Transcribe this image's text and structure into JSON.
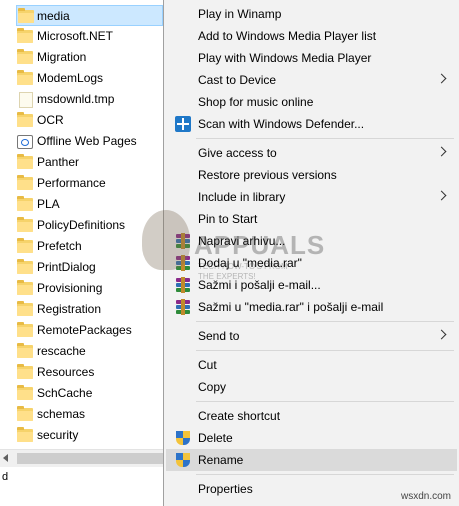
{
  "explorer": {
    "files": [
      {
        "name": "media",
        "type": "folder",
        "selected": true
      },
      {
        "name": "Microsoft.NET",
        "type": "folder"
      },
      {
        "name": "Migration",
        "type": "folder"
      },
      {
        "name": "ModemLogs",
        "type": "folder"
      },
      {
        "name": "msdownld.tmp",
        "type": "file"
      },
      {
        "name": "OCR",
        "type": "folder"
      },
      {
        "name": "Offline Web Pages",
        "type": "shortcut"
      },
      {
        "name": "Panther",
        "type": "folder"
      },
      {
        "name": "Performance",
        "type": "folder"
      },
      {
        "name": "PLA",
        "type": "folder"
      },
      {
        "name": "PolicyDefinitions",
        "type": "folder"
      },
      {
        "name": "Prefetch",
        "type": "folder"
      },
      {
        "name": "PrintDialog",
        "type": "folder"
      },
      {
        "name": "Provisioning",
        "type": "folder"
      },
      {
        "name": "Registration",
        "type": "folder"
      },
      {
        "name": "RemotePackages",
        "type": "folder"
      },
      {
        "name": "rescache",
        "type": "folder"
      },
      {
        "name": "Resources",
        "type": "folder"
      },
      {
        "name": "SchCache",
        "type": "folder"
      },
      {
        "name": "schemas",
        "type": "folder"
      },
      {
        "name": "security",
        "type": "folder"
      }
    ],
    "status_mark": "d"
  },
  "context_menu": {
    "items": [
      {
        "label": "Play in Winamp"
      },
      {
        "label": "Add to Windows Media Player list"
      },
      {
        "label": "Play with Windows Media Player"
      },
      {
        "label": "Cast to Device",
        "submenu": true
      },
      {
        "label": "Shop for music online"
      },
      {
        "label": "Scan with Windows Defender...",
        "icon": "defender"
      },
      {
        "separator": true
      },
      {
        "label": "Give access to",
        "submenu": true
      },
      {
        "label": "Restore previous versions"
      },
      {
        "label": "Include in library",
        "submenu": true
      },
      {
        "label": "Pin to Start"
      },
      {
        "label": "Napravi arhivu...",
        "icon": "winrar"
      },
      {
        "label": "Dodaj u \"media.rar\"",
        "icon": "winrar"
      },
      {
        "label": "Sažmi i pošalji e-mail...",
        "icon": "winrar"
      },
      {
        "label": "Sažmi u \"media.rar\" i pošalji e-mail",
        "icon": "winrar"
      },
      {
        "separator": true
      },
      {
        "label": "Send to",
        "submenu": true
      },
      {
        "separator": true
      },
      {
        "label": "Cut"
      },
      {
        "label": "Copy"
      },
      {
        "separator": true
      },
      {
        "label": "Create shortcut"
      },
      {
        "label": "Delete",
        "icon": "uac-shield"
      },
      {
        "label": "Rename",
        "icon": "uac-shield",
        "hover": true
      },
      {
        "separator": true
      },
      {
        "label": "Properties"
      }
    ]
  },
  "watermark": {
    "title": "APPUALS",
    "subtitle_line1": "TECH HOW-TO'S FROM",
    "subtitle_line2": "THE EXPERTS!"
  },
  "site_tag": "wsxdn.com"
}
